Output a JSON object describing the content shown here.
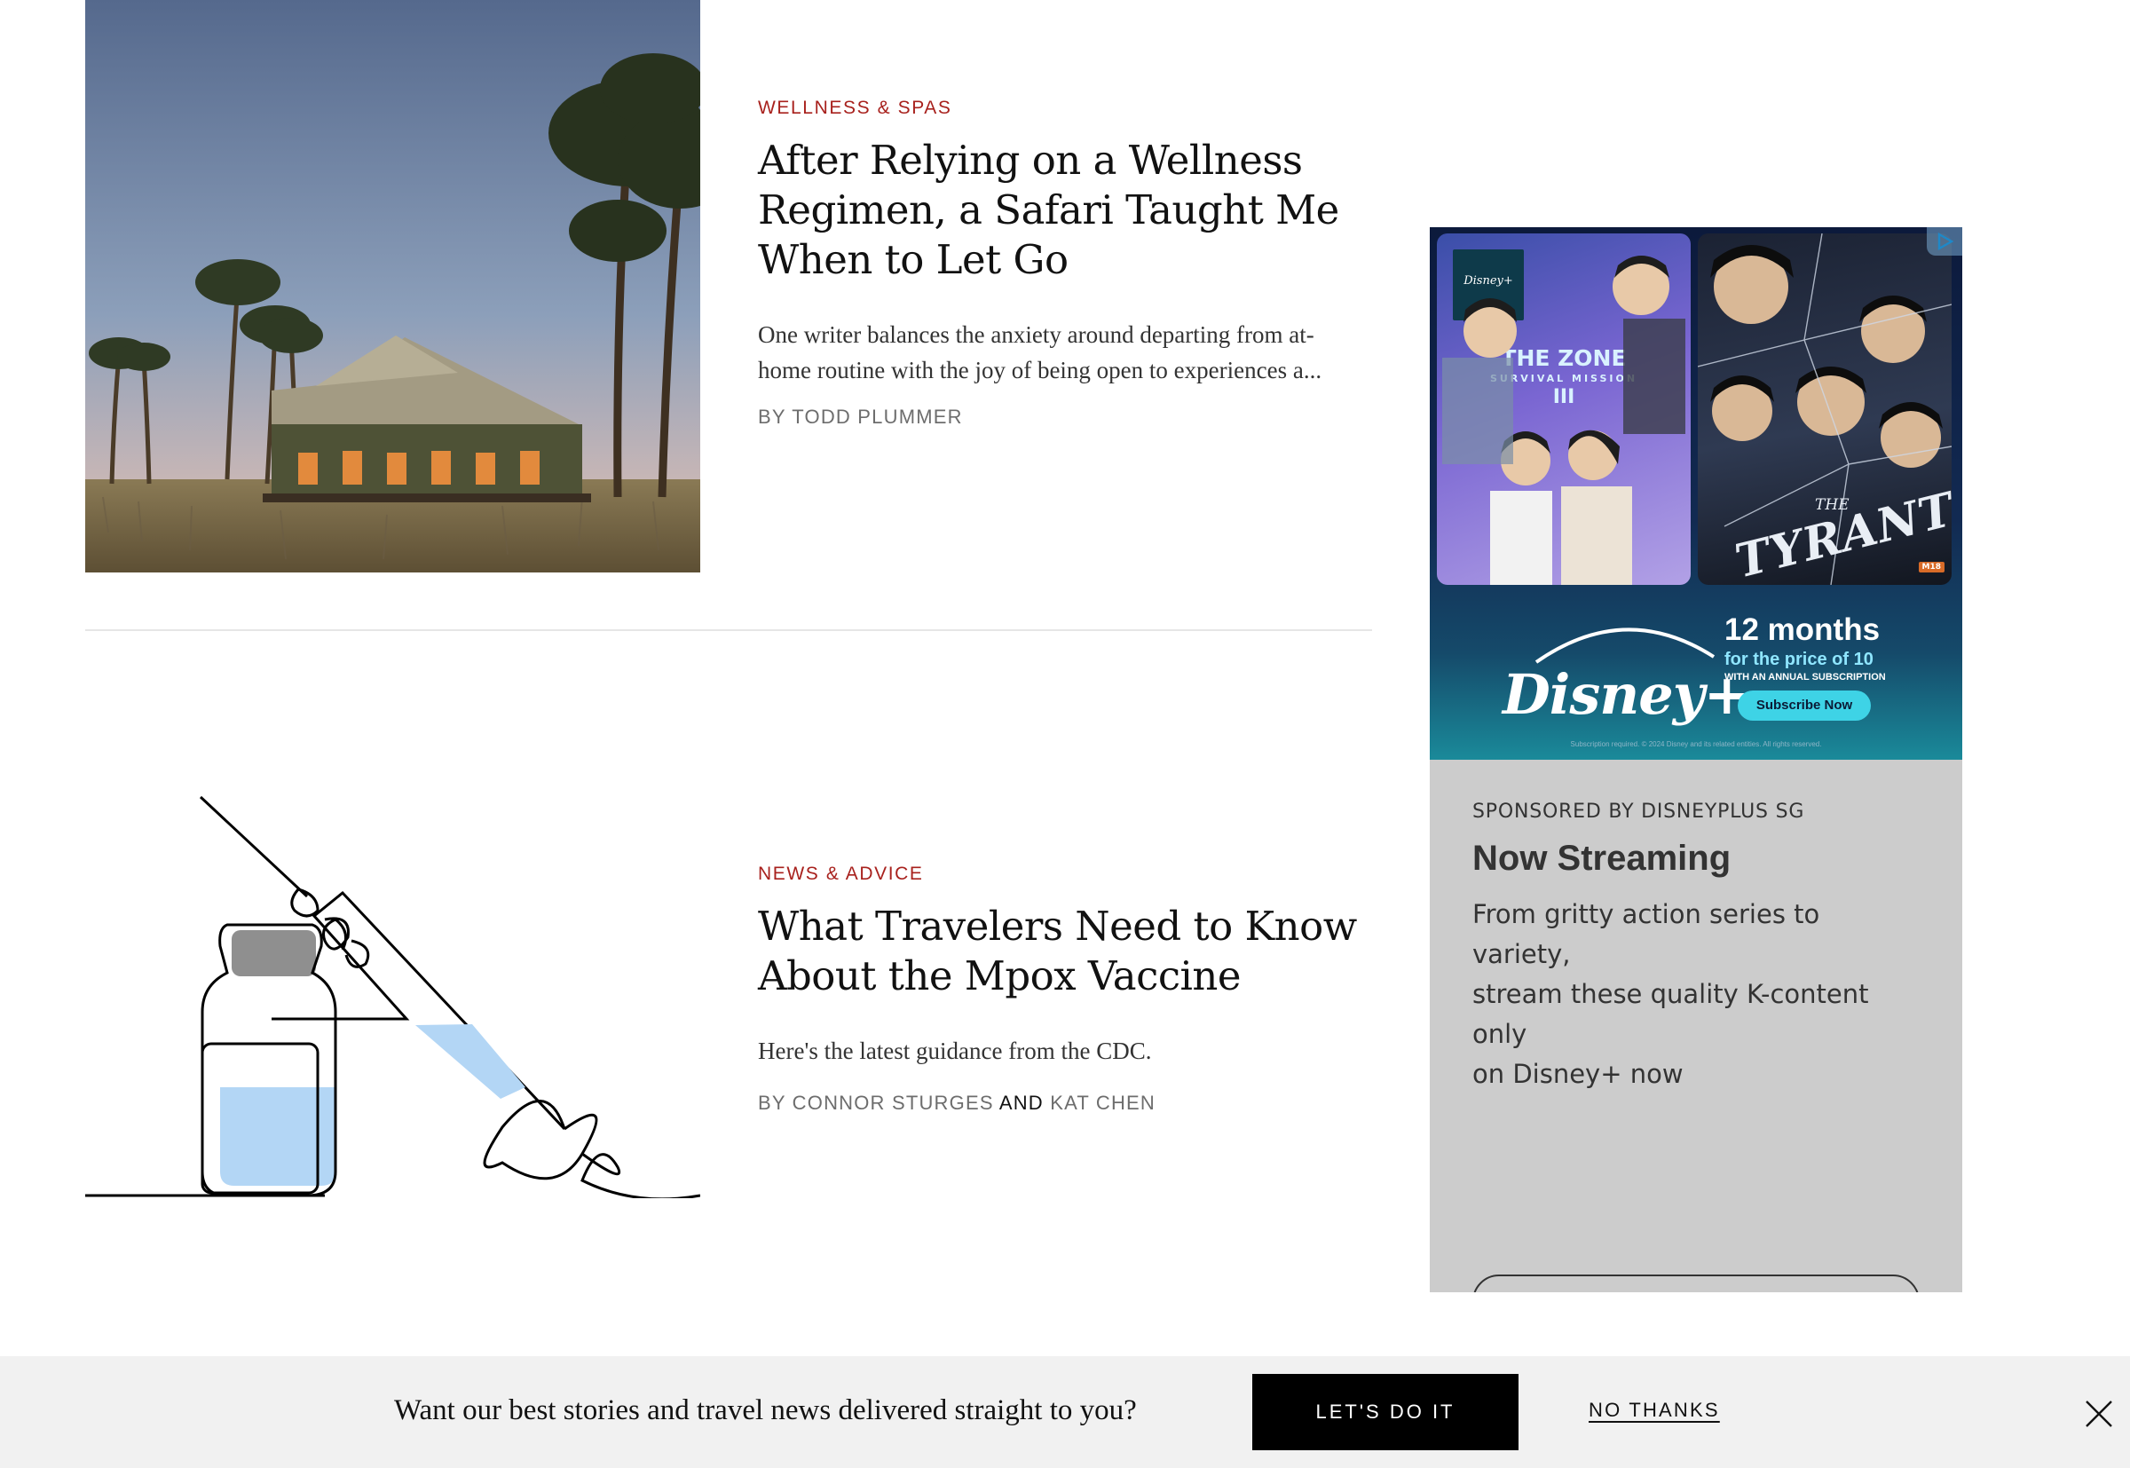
{
  "articles": [
    {
      "rubric": "Wellness & Spas",
      "headline_lines": [
        "After Relying on a Wellness",
        "Regimen, a Safari Taught Me",
        "When to Let Go"
      ],
      "dek_lines": [
        "One writer balances the anxiety around departing from at-",
        "home routine with the joy of being open to experiences a..."
      ],
      "byline": "By Todd Plummer",
      "image_icon": "safari-tent-photo"
    },
    {
      "rubric": "News & Advice",
      "headline_lines": [
        "What Travelers Need to Know",
        "About the Mpox Vaccine"
      ],
      "dek": "Here's the latest guidance from the CDC.",
      "byline_prefix": "By",
      "author_1": "Connor Sturges",
      "byline_and": "and",
      "author_2": "Kat Chen",
      "image_icon": "vaccine-syringe-illustration"
    }
  ],
  "ad": {
    "creative": {
      "poster_1_brand": "Disney+",
      "poster_1_title": "THE ZONE",
      "poster_1_subtitle": "SURVIVAL MISSION",
      "poster_1_season": "III",
      "poster_2_the": "THE",
      "poster_2_title": "TYRANT",
      "poster_2_rating": "M18",
      "logo": "Disney+",
      "offer_big": "12 months",
      "offer_mid": "for the price of 10",
      "offer_small": "WITH AN ANNUAL SUBSCRIPTION",
      "offer_button": "Subscribe Now",
      "legal": "Subscription required. © 2024 Disney and its related entities. All rights reserved."
    },
    "sponsor": "Sponsored by DisneyPlus SG",
    "heading": "Now Streaming",
    "body_lines": [
      "From gritty action series to variety,",
      "stream these quality K-content only",
      "on Disney+ now"
    ]
  },
  "newsletter": {
    "prompt": "Want our best stories and travel news delivered straight to you?",
    "accept_label": "LET'S DO IT",
    "decline_label": "NO THANKS"
  },
  "colors": {
    "rubric": "#a8211d",
    "ad_panel": "#cccccc",
    "newsletter_bg": "#f1f1f1",
    "accent_button": "#000000"
  }
}
